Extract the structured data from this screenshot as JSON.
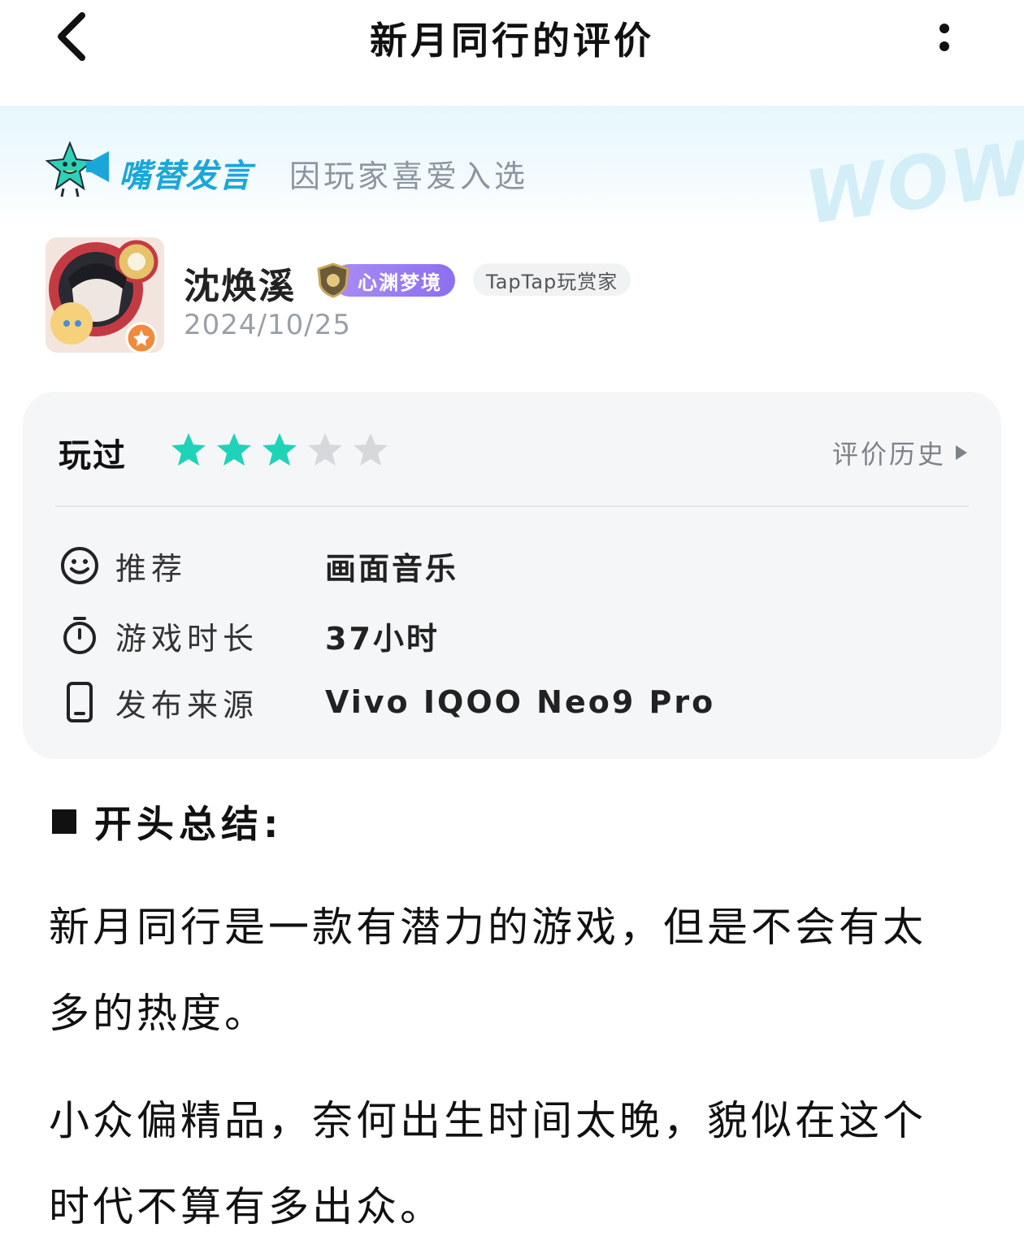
{
  "nav": {
    "title": "新月同行的评价",
    "back_icon": "chevron-left-icon",
    "more_icon": "more-vertical-icon"
  },
  "banner": {
    "title": "嘴替发言",
    "subtitle": "因玩家喜爱入选",
    "watermark": "WOW!",
    "colors": {
      "title": "#1aa7d8",
      "mascot": "#2fd1b4",
      "megaphone": "#1aa7d8"
    }
  },
  "user": {
    "name": "沈焕溪",
    "rank_badge": "心渊梦境",
    "tag": "TapTap玩赏家",
    "date": "2024/10/25"
  },
  "review": {
    "status_label": "玩过",
    "rating": 3,
    "max_rating": 5,
    "history_label": "评价历史",
    "star_colors": {
      "filled": "#1fd3b8",
      "empty": "#d6d8dc"
    },
    "info": [
      {
        "icon": "smiley-icon",
        "key": "推荐",
        "value": "画面音乐"
      },
      {
        "icon": "stopwatch-icon",
        "key": "游戏时长",
        "value": "37小时"
      },
      {
        "icon": "phone-icon",
        "key": "发布来源",
        "value": "Vivo IQOO Neo9 Pro"
      }
    ]
  },
  "body": {
    "heading": "开头总结:",
    "paragraphs": [
      "新月同行是一款有潜力的游戏，但是不会有太多的热度。",
      "小众偏精品，奈何出生时间太晚，貌似在这个时代不算有多出众。"
    ]
  }
}
